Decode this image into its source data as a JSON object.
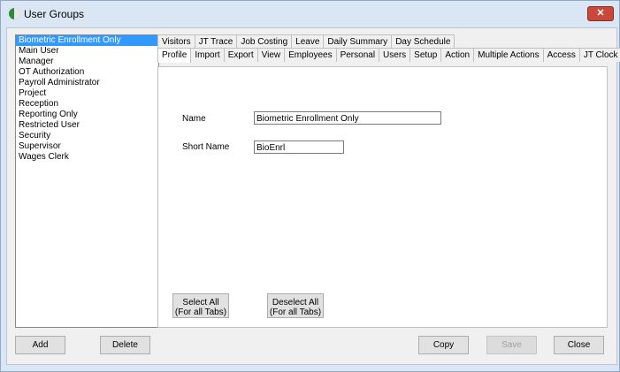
{
  "window": {
    "title": "User Groups",
    "close_glyph": "✕"
  },
  "groups": [
    "Biometric Enrollment Only",
    "Main User",
    "Manager",
    "OT Authorization",
    "Payroll Administrator",
    "Project",
    "Reception",
    "Reporting Only",
    "Restricted User",
    "Security",
    "Supervisor",
    "Wages Clerk"
  ],
  "selected_group": "Biometric Enrollment Only",
  "tabs_back": [
    "Visitors",
    "JT Trace",
    "Job Costing",
    "Leave",
    "Daily Summary",
    "Day Schedule"
  ],
  "tabs_front": [
    "Profile",
    "Import",
    "Export",
    "View",
    "Employees",
    "Personal",
    "Users",
    "Setup",
    "Action",
    "Multiple Actions",
    "Access",
    "JT Clock"
  ],
  "active_tab": "Profile",
  "profile": {
    "name_label": "Name",
    "name_value": "Biometric Enrollment Only",
    "short_name_label": "Short Name",
    "short_name_value": "BioEnrl",
    "select_all_line1": "Select All",
    "select_all_line2": "(For all Tabs)",
    "deselect_all_line1": "Deselect All",
    "deselect_all_line2": "(For all Tabs)"
  },
  "buttons": {
    "add": "Add",
    "delete": "Delete",
    "copy": "Copy",
    "save": "Save",
    "close": "Close"
  },
  "colors": {
    "selection": "#3399ff",
    "close_button": "#c9483a"
  }
}
